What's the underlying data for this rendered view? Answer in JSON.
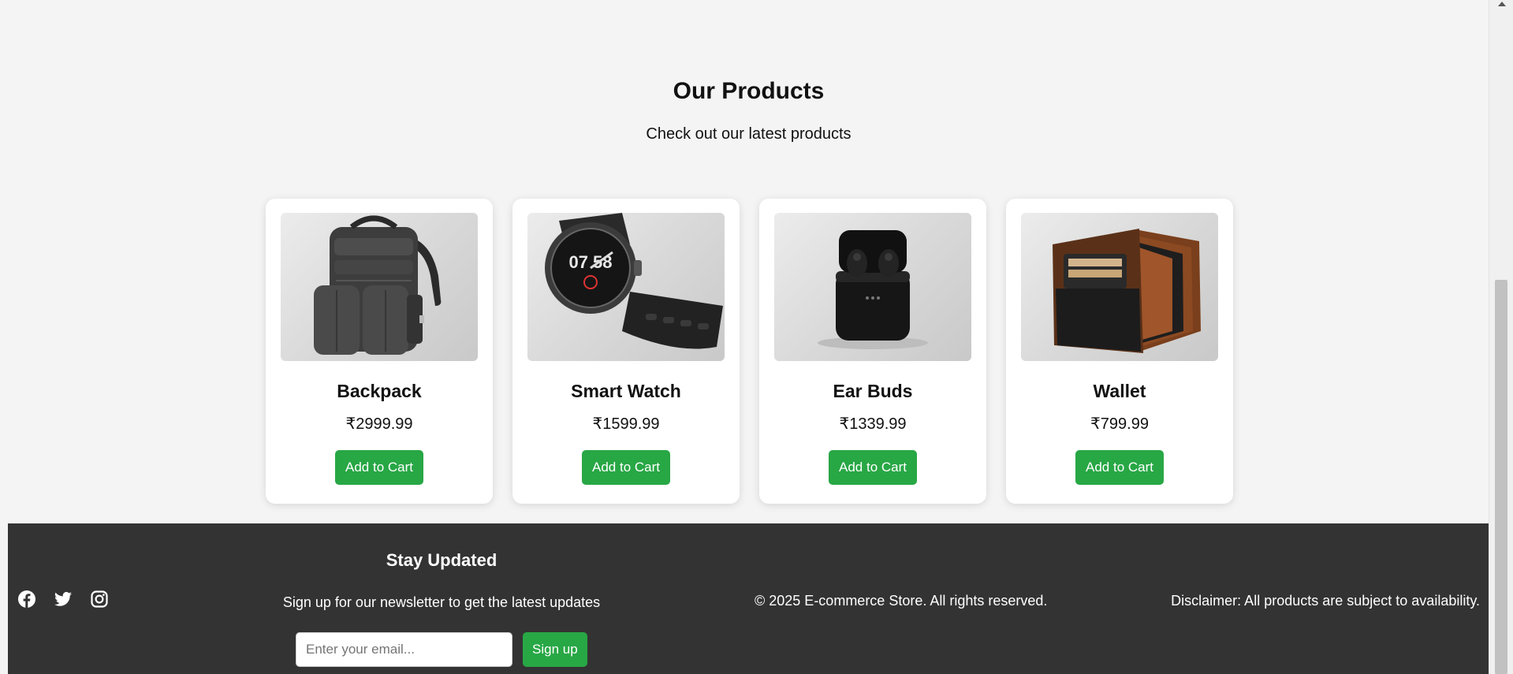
{
  "products_section": {
    "title": "Our Products",
    "subtitle": "Check out our latest products",
    "products": [
      {
        "name": "Backpack",
        "price": "₹2999.99",
        "button_label": "Add to Cart",
        "image": "backpack-photo"
      },
      {
        "name": "Smart Watch",
        "price": "₹1599.99",
        "button_label": "Add to Cart",
        "image": "smart-watch-photo"
      },
      {
        "name": "Ear Buds",
        "price": "₹1339.99",
        "button_label": "Add to Cart",
        "image": "ear-buds-photo"
      },
      {
        "name": "Wallet",
        "price": "₹799.99",
        "button_label": "Add to Cart",
        "image": "wallet-photo"
      }
    ]
  },
  "footer": {
    "social_icons": [
      "facebook-icon",
      "twitter-icon",
      "instagram-icon"
    ],
    "newsletter": {
      "title": "Stay Updated",
      "text": "Sign up for our newsletter to get the latest updates",
      "email_placeholder": "Enter your email...",
      "button_label": "Sign up"
    },
    "copyright": "© 2025 E-commerce Store. All rights reserved.",
    "disclaimer": "Disclaimer: All products are subject to availability."
  },
  "colors": {
    "page_background": "#f4f4f4",
    "card_background": "#ffffff",
    "button_green": "#28a745",
    "footer_background": "#333333",
    "footer_text": "#ffffff"
  }
}
